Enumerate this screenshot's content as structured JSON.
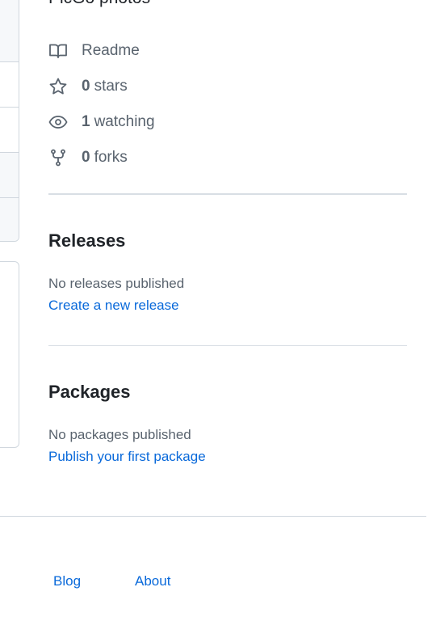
{
  "about": {
    "description": "PicGo photos",
    "meta": [
      {
        "icon": "book-icon",
        "count": "",
        "label": "Readme"
      },
      {
        "icon": "star-icon",
        "count": "0",
        "label": "stars"
      },
      {
        "icon": "eye-icon",
        "count": "1",
        "label": "watching"
      },
      {
        "icon": "fork-icon",
        "count": "0",
        "label": "forks"
      }
    ]
  },
  "releases": {
    "title": "Releases",
    "empty_text": "No releases published",
    "create_link": "Create a new release"
  },
  "packages": {
    "title": "Packages",
    "empty_text": "No packages published",
    "publish_link": "Publish your first package"
  },
  "footer": {
    "links": [
      "",
      "Blog",
      "About"
    ]
  },
  "colors": {
    "link": "#0969da",
    "muted": "#59636e",
    "border": "#d0d7de",
    "text": "#1f2328"
  }
}
